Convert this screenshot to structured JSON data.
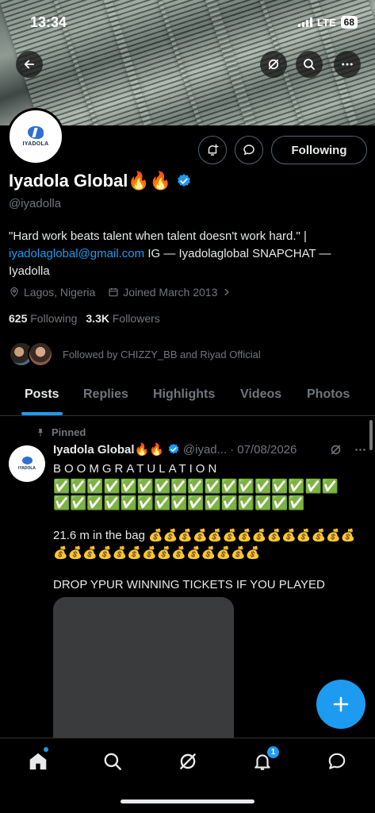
{
  "status_bar": {
    "time": "13:34",
    "network": "LTE",
    "battery": "68"
  },
  "profile": {
    "name": "Iyadola Global🔥🔥",
    "handle": "@iyadolla",
    "avatar_text": "IYADOLA",
    "bio_text": "\"Hard work beats talent when talent doesn't work hard.\" |",
    "bio_link": "iyadolaglobal@gmail.com",
    "bio_rest": " IG — Iyadolaglobal SNAPCHAT — Iyadolla",
    "location": "Lagos, Nigeria",
    "joined": "Joined March 2013",
    "following_count": "625",
    "following_label": "Following",
    "followers_count": "3.3K",
    "followers_label": "Followers",
    "followed_by": "Followed by CHIZZY_BB and Riyad Official"
  },
  "actions": {
    "following_button": "Following"
  },
  "tabs": [
    {
      "label": "Posts"
    },
    {
      "label": "Replies"
    },
    {
      "label": "Highlights"
    },
    {
      "label": "Videos"
    },
    {
      "label": "Photos"
    }
  ],
  "tweet": {
    "pinned_label": "Pinned",
    "author_name": "Iyadola Global🔥🔥",
    "handle": "@iyad...",
    "date": "· 07/08/2026",
    "line1": "BOOMGRATULATION",
    "line2": "✅✅✅✅✅✅✅✅✅✅✅✅✅✅✅✅✅",
    "line3": "✅✅✅✅✅✅✅✅✅✅✅✅✅✅✅",
    "line4": "21.6 m in the bag 💰💰💰💰💰💰💰💰💰💰💰💰💰💰💰💰💰💰💰💰💰💰💰💰💰💰💰💰",
    "line5": "DROP YPUR WINNING TICKETS IF YOU PLAYED"
  },
  "nav": {
    "notifications_badge": "1"
  },
  "colors": {
    "accent": "#1d9bf0",
    "background": "#000000",
    "muted": "#71767b"
  },
  "icons": [
    "back-arrow-icon",
    "grok-icon",
    "search-icon",
    "more-icon",
    "add-notification-icon",
    "message-icon",
    "verified-badge-icon",
    "location-icon",
    "calendar-icon",
    "chevron-right-icon",
    "pin-icon",
    "compose-plus-icon",
    "home-icon",
    "notifications-icon",
    "messages-icon"
  ]
}
